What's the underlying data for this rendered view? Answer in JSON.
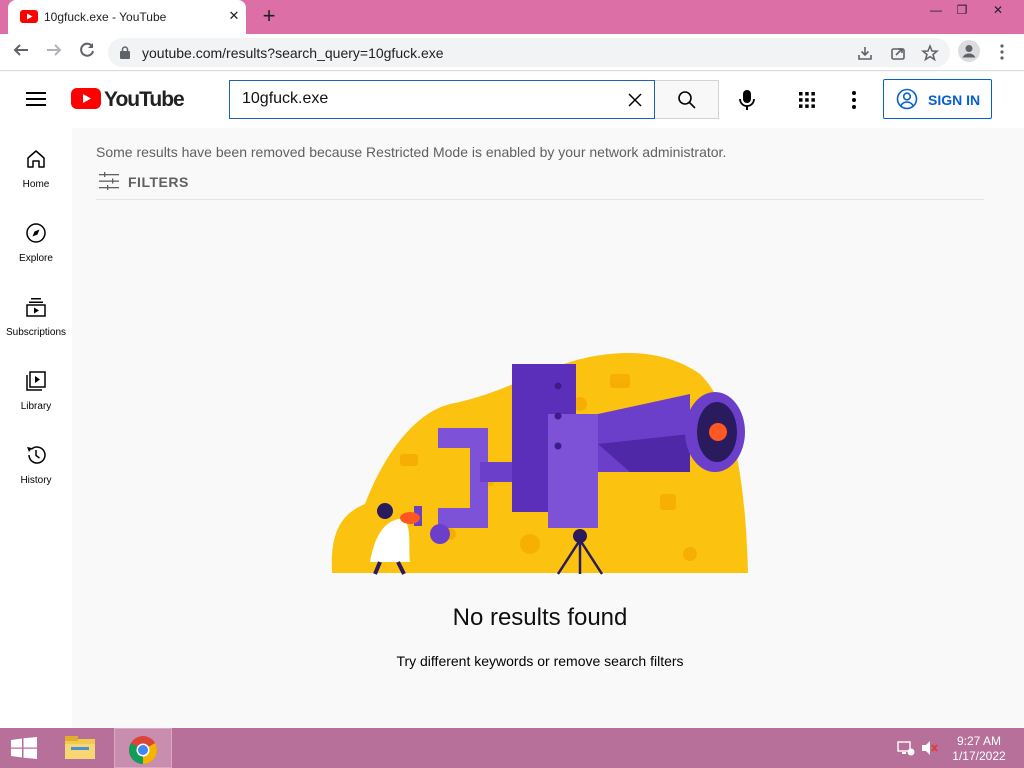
{
  "browser": {
    "tab_title": "10gfuck.exe - YouTube",
    "tab_close": "✕",
    "new_tab": "+",
    "window_controls": {
      "minimize": "—",
      "restore": "❐",
      "close": "✕"
    },
    "url": "youtube.com/results?search_query=10gfuck.exe"
  },
  "youtube": {
    "logo_text": "YouTube",
    "search_query": "10gfuck.exe",
    "sign_in_label": "SIGN IN",
    "sidebar": {
      "items": [
        {
          "label": "Home",
          "icon": "home-icon"
        },
        {
          "label": "Explore",
          "icon": "compass-icon"
        },
        {
          "label": "Subscriptions",
          "icon": "subscriptions-icon"
        },
        {
          "label": "Library",
          "icon": "library-icon"
        },
        {
          "label": "History",
          "icon": "history-icon"
        }
      ]
    },
    "restricted_notice": "Some results have been removed because Restricted Mode is enabled by your network administrator.",
    "filters_label": "FILTERS",
    "empty_title": "No results found",
    "empty_subtitle": "Try different keywords or remove search filters"
  },
  "taskbar": {
    "time": "9:27 AM",
    "date": "1/17/2022"
  },
  "colors": {
    "titlebar": "#dc6fa6",
    "taskbar": "#b6709a",
    "youtube_red": "#ff0000",
    "signin_blue": "#065fd4",
    "illustration_yellow": "#fbc310",
    "illustration_purple": "#6b3fc9"
  }
}
